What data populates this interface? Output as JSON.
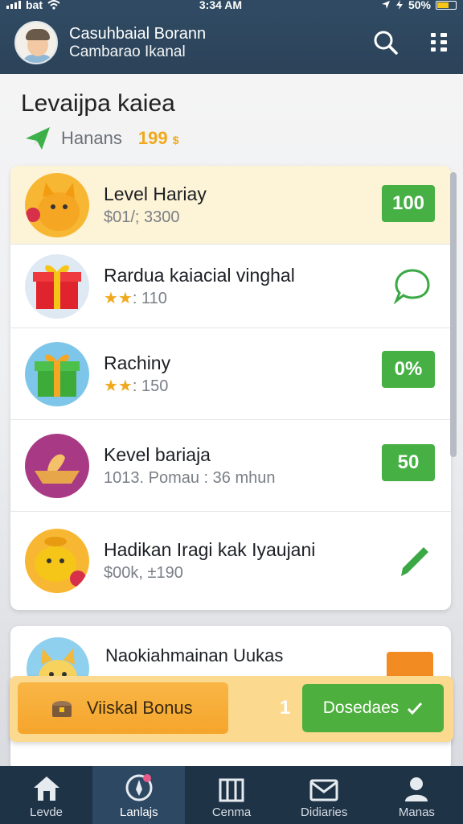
{
  "status_bar": {
    "carrier": "bat",
    "time": "3:34 AM",
    "battery": "50%"
  },
  "header": {
    "name": "Casuhbaial Borann",
    "subtitle": "Cambarao Ikanal"
  },
  "page": {
    "title": "Levaijpa kaiea",
    "sub_label": "Hanans",
    "sub_value": "199",
    "sub_unit": "$"
  },
  "list": [
    {
      "name": "Level Hariay",
      "sub": "$01/; 3300",
      "badge": "100",
      "highlighted": true,
      "icon": "cat-icon"
    },
    {
      "name": "Rardua kaiacial vinghal",
      "stars": "★★",
      "sub": ": 110",
      "action": "chat-bubble-icon",
      "icon": "gift-icon"
    },
    {
      "name": "Rachiny",
      "stars": "★★",
      "sub": ": 150",
      "badge": "0%",
      "icon": "gift-icon"
    },
    {
      "name": "Kevel bariaja",
      "sub": "1013. Pomau : 36 mhun",
      "badge": "50",
      "icon": "bowl-icon"
    },
    {
      "name": "Hadikan Iragi kak Iyaujani",
      "sub": "$00k, ±190",
      "action": "pencil-icon",
      "icon": "pig-icon"
    }
  ],
  "second_card": {
    "name": "Naokiahmainan Uukas"
  },
  "bonus_bar": {
    "bonus_label": "Viiskal Bonus",
    "count": "1",
    "download_label": "Dosedaes"
  },
  "tabs": [
    {
      "label": "Levde",
      "icon": "home-icon"
    },
    {
      "label": "Lanlajs",
      "icon": "compass-icon"
    },
    {
      "label": "Cenma",
      "icon": "building-icon"
    },
    {
      "label": "Didiaries",
      "icon": "mail-icon"
    },
    {
      "label": "Manas",
      "icon": "user-icon"
    }
  ],
  "colors": {
    "header": "#2f4a62",
    "accent_green": "#46b045",
    "accent_orange": "#f5a52c",
    "gold": "#f0a91c",
    "tabbar": "#1f3346"
  }
}
